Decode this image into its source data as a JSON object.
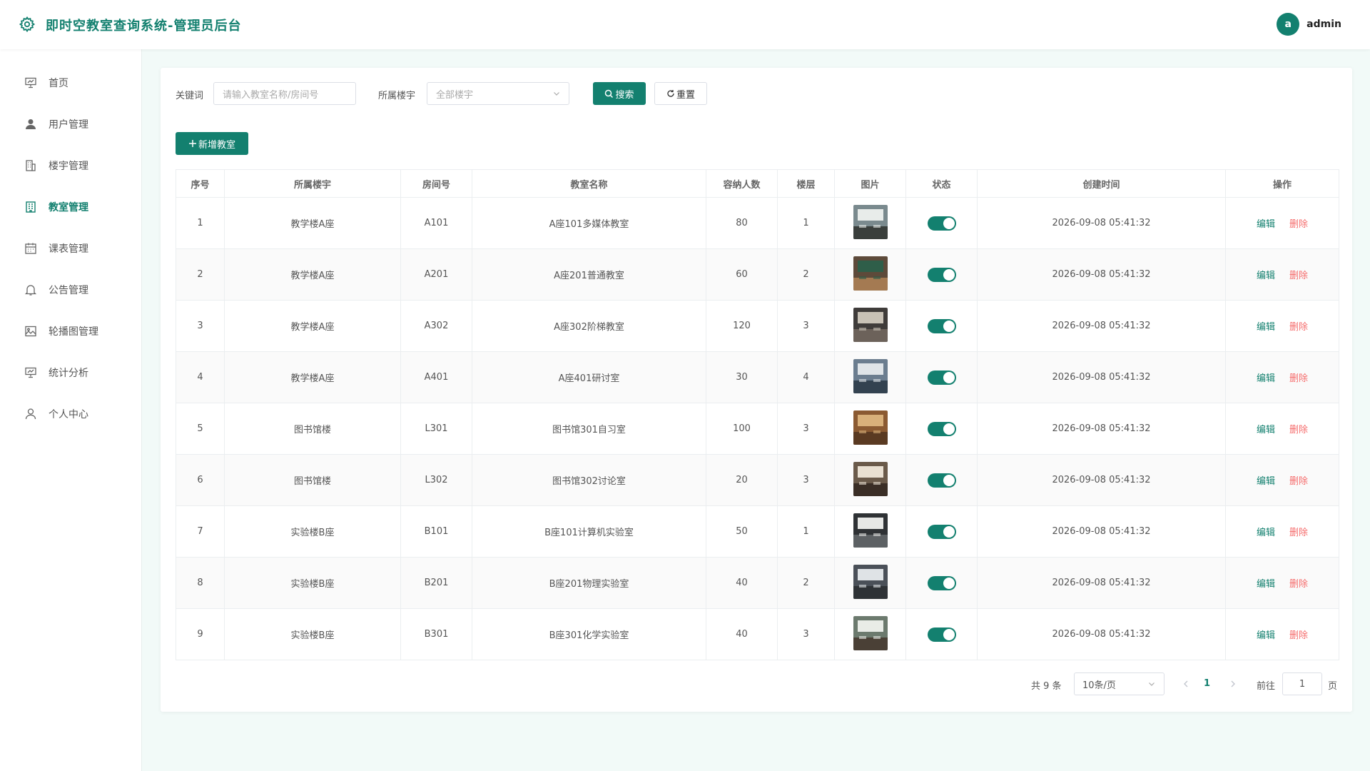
{
  "app": {
    "title": "即时空教室查询系统-管理员后台"
  },
  "user": {
    "avatar_letter": "a",
    "name": "admin"
  },
  "sidebar": {
    "items": [
      {
        "label": "首页",
        "icon": "presentation-board-icon",
        "active": false
      },
      {
        "label": "用户管理",
        "icon": "user-icon",
        "active": false
      },
      {
        "label": "楼宇管理",
        "icon": "office-building-icon",
        "active": false
      },
      {
        "label": "教室管理",
        "icon": "classroom-building-icon",
        "active": true
      },
      {
        "label": "课表管理",
        "icon": "calendar-icon",
        "active": false
      },
      {
        "label": "公告管理",
        "icon": "bell-icon",
        "active": false
      },
      {
        "label": "轮播图管理",
        "icon": "picture-icon",
        "active": false
      },
      {
        "label": "统计分析",
        "icon": "chart-board-icon",
        "active": false
      },
      {
        "label": "个人中心",
        "icon": "user-outline-icon",
        "active": false
      }
    ]
  },
  "filters": {
    "keyword_label": "关键词",
    "keyword_value": "",
    "keyword_placeholder": "请输入教室名称/房间号",
    "building_label": "所属楼宇",
    "building_selected": "全部楼宇",
    "search_label": "搜索",
    "reset_label": "重置"
  },
  "toolbar": {
    "add_label": "新增教室"
  },
  "table": {
    "columns": [
      "序号",
      "所属楼宇",
      "房间号",
      "教室名称",
      "容纳人数",
      "楼层",
      "图片",
      "状态",
      "创建时间",
      "操作"
    ],
    "rows": [
      {
        "no": "1",
        "building": "教学楼A座",
        "room": "A101",
        "name": "A座101多媒体教室",
        "capacity": "80",
        "floor": "1",
        "status": true,
        "created": "2026-09-08 05:41:32"
      },
      {
        "no": "2",
        "building": "教学楼A座",
        "room": "A201",
        "name": "A座201普通教室",
        "capacity": "60",
        "floor": "2",
        "status": true,
        "created": "2026-09-08 05:41:32"
      },
      {
        "no": "3",
        "building": "教学楼A座",
        "room": "A302",
        "name": "A座302阶梯教室",
        "capacity": "120",
        "floor": "3",
        "status": true,
        "created": "2026-09-08 05:41:32"
      },
      {
        "no": "4",
        "building": "教学楼A座",
        "room": "A401",
        "name": "A座401研讨室",
        "capacity": "30",
        "floor": "4",
        "status": true,
        "created": "2026-09-08 05:41:32"
      },
      {
        "no": "5",
        "building": "图书馆楼",
        "room": "L301",
        "name": "图书馆301自习室",
        "capacity": "100",
        "floor": "3",
        "status": true,
        "created": "2026-09-08 05:41:32"
      },
      {
        "no": "6",
        "building": "图书馆楼",
        "room": "L302",
        "name": "图书馆302讨论室",
        "capacity": "20",
        "floor": "3",
        "status": true,
        "created": "2026-09-08 05:41:32"
      },
      {
        "no": "7",
        "building": "实验楼B座",
        "room": "B101",
        "name": "B座101计算机实验室",
        "capacity": "50",
        "floor": "1",
        "status": true,
        "created": "2026-09-08 05:41:32"
      },
      {
        "no": "8",
        "building": "实验楼B座",
        "room": "B201",
        "name": "B座201物理实验室",
        "capacity": "40",
        "floor": "2",
        "status": true,
        "created": "2026-09-08 05:41:32"
      },
      {
        "no": "9",
        "building": "实验楼B座",
        "room": "B301",
        "name": "B座301化学实验室",
        "capacity": "40",
        "floor": "3",
        "status": true,
        "created": "2026-09-08 05:41:32"
      }
    ],
    "edit_label": "编辑",
    "delete_label": "删除"
  },
  "pagination": {
    "total_text": "共 9 条",
    "page_size": "10条/页",
    "current_page": "1",
    "goto_label": "前往",
    "goto_value": "1",
    "page_unit": "页"
  },
  "colors": {
    "primary": "#13806f",
    "danger": "#f56c6c",
    "background": "#f2faf8"
  }
}
